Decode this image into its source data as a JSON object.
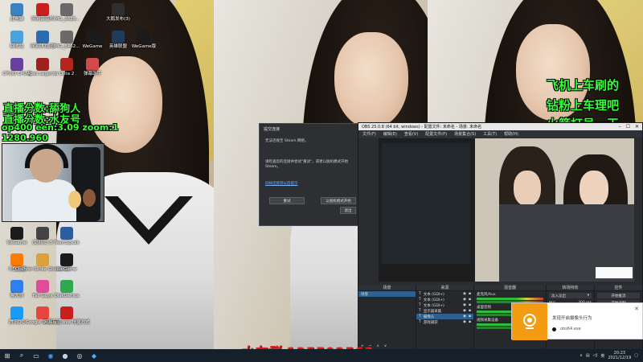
{
  "overlay": {
    "line1": "直播分数:舔狗人",
    "line2": "直播分数:水友号",
    "line3": "op400 een:3.09 zoom:1",
    "line4": "1280.960",
    "right1": "飞机上车刷的",
    "right2": "钻粉上车理吧",
    "right3": "火箭打号一天"
  },
  "desktop_icons": [
    {
      "label": "此电脑",
      "icon": "computer-icon",
      "color": "#3b82c4"
    },
    {
      "label": "网易云音乐",
      "icon": "music-icon",
      "color": "#c81e1e"
    },
    {
      "label": "IMG_2628...",
      "icon": "image-icon",
      "color": "#6a6a6a"
    },
    {
      "label": "大鹅发布(3)",
      "icon": "game-icon",
      "color": "#2e2e2e"
    },
    {
      "label": "回收站",
      "icon": "recycle-icon",
      "color": "#4aa3df"
    },
    {
      "label": "网易UU加速",
      "icon": "speed-icon",
      "color": "#2b6cb0"
    },
    {
      "label": "IMG_8462...",
      "icon": "image-icon",
      "color": "#6a6a6a"
    },
    {
      "label": "WeGame",
      "icon": "wegame-icon",
      "color": "#1b1b1b"
    },
    {
      "label": "英雄联盟",
      "icon": "lol-icon",
      "color": "#1f3d5a"
    },
    {
      "label": "WeGame版",
      "icon": "wegame-icon",
      "color": "#1b1b1b"
    },
    {
      "label": "CPUID CPU-Z",
      "icon": "cpu-icon",
      "color": "#6b3fa0"
    },
    {
      "label": "Apex Legends",
      "icon": "apex-icon",
      "color": "#a01f1f"
    },
    {
      "label": "Dota 2",
      "icon": "dota-icon",
      "color": "#b3261e"
    },
    {
      "label": "弹幕助手",
      "icon": "chat-icon",
      "color": "#d24a4a"
    },
    {
      "label": "WeGame",
      "icon": "wegame-icon",
      "color": "#1b1b1b"
    },
    {
      "label": "(剑网三) 5",
      "icon": "game-icon",
      "color": "#444"
    },
    {
      "label": "TeamSpeak",
      "icon": "teamspeak-icon",
      "color": "#2a5d9f"
    },
    {
      "label": "斗鱼直播",
      "icon": "douyu-icon",
      "color": "#ff7a00"
    },
    {
      "label": "Counter-Strike Global Off",
      "icon": "csgo-icon",
      "color": "#d9a23b"
    },
    {
      "label": "WeGame",
      "icon": "wegame-icon",
      "color": "#1b1b1b"
    },
    {
      "label": "鲁大师",
      "icon": "ludashi-icon",
      "color": "#2f80ed"
    },
    {
      "label": "Fall Guys",
      "icon": "fallguys-icon",
      "color": "#e04c9b"
    },
    {
      "label": "DiskGenius",
      "icon": "disk-icon",
      "color": "#2fa84f"
    },
    {
      "label": "腾讯QQ",
      "icon": "qq-icon",
      "color": "#1b9af7"
    },
    {
      "label": "Google Chrome",
      "icon": "chrome-icon",
      "color": "#e8453c"
    },
    {
      "label": "网易有道.exe 快捷方式",
      "icon": "youdao-icon",
      "color": "#c81e1e"
    }
  ],
  "dialog": {
    "title": "提交连接",
    "message": "无法连接至 Steam 网络。",
    "detail": "请检查您的连接并尝试\"重试\"，或者以脱机模式开始 Steam。",
    "link": "同样连接到以后提示",
    "retry_label": "重试",
    "offline_label": "以脱机模式开始",
    "quit_label": "退出"
  },
  "obs": {
    "title": "OBS 25.0.8 (64 bit, windows) - 配置文件: 未命名 - 场景: 未命名",
    "menus": [
      "文件(F)",
      "编辑(E)",
      "查看(V)",
      "配置文件(P)",
      "场景集合(S)",
      "工具(T)",
      "帮助(H)"
    ],
    "dock_scenes": "场景",
    "dock_sources": "来源",
    "dock_mixer": "混音器",
    "dock_transitions": "转场特效",
    "dock_controls": "控件",
    "scene_item": "场景",
    "sources": [
      "文本 (GDI+)",
      "文本 (GDI+)",
      "文本 (GDI+)",
      "显示器采集",
      "摄像头",
      "游戏捕获"
    ],
    "mixer_items": [
      "麦克风/Aux",
      "桌面音频",
      "视频采集设备"
    ],
    "transition_value": "淡入淡出",
    "duration_label": "时长",
    "duration_value": "300 ms",
    "controls": [
      "开始推流",
      "开始录制",
      "工作室模式",
      "设置",
      "退出"
    ],
    "status": "LIVE: 00:00:00  REC: 00:00:00  CPU: 3.3%, 30.00 fps"
  },
  "notification": {
    "caption": "发现开启摄像头行为",
    "app": "obs64.exe"
  },
  "banner": {
    "text": "水友群 135502563"
  },
  "taskbar": {
    "time": "20:23",
    "date": "2021/12/19",
    "lang": "英",
    "icons": [
      "start-icon",
      "search-icon",
      "taskview-icon",
      "edge-icon",
      "steam-icon",
      "obs-icon",
      "qq-icon"
    ]
  }
}
